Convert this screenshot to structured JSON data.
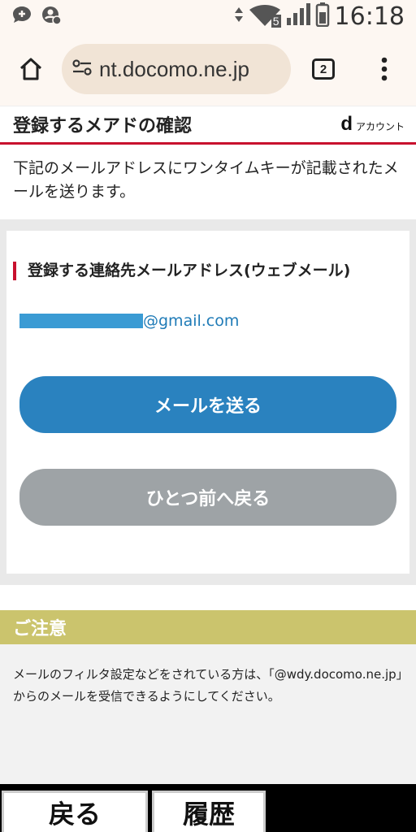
{
  "status_bar": {
    "time": "16:18",
    "network_badge": "5",
    "icons": [
      "chat-bubble-icon",
      "account-sync-icon",
      "data-arrows-icon",
      "wifi-icon",
      "signal-icon",
      "battery-icon"
    ]
  },
  "browser": {
    "url": "nt.docomo.ne.jp",
    "tab_count": "2"
  },
  "page": {
    "title": "登録するメアドの確認",
    "account_brand_d": "d",
    "account_brand_text": "アカウント",
    "intro": "下記のメールアドレスにワンタイムキーが記載されたメールを送ります。",
    "section_label": "登録する連絡先メールアドレス(ウェブメール)",
    "email_domain": "@gmail.com",
    "send_button": "メールを送る",
    "back_button": "ひとつ前へ戻る",
    "notice_title": "ご注意",
    "notice_text": "メールのフィルタ設定などをされている方は、「@wdy.docomo.ne.jp」からのメールを受信できるようにしてください。"
  },
  "hardware_keys": {
    "back": "戻る",
    "history": "履歴"
  },
  "colors": {
    "accent_red": "#c8102e",
    "primary_blue": "#2a82bf",
    "secondary_gray": "#9ea3a6",
    "notice_yellow": "#cbc46d"
  }
}
